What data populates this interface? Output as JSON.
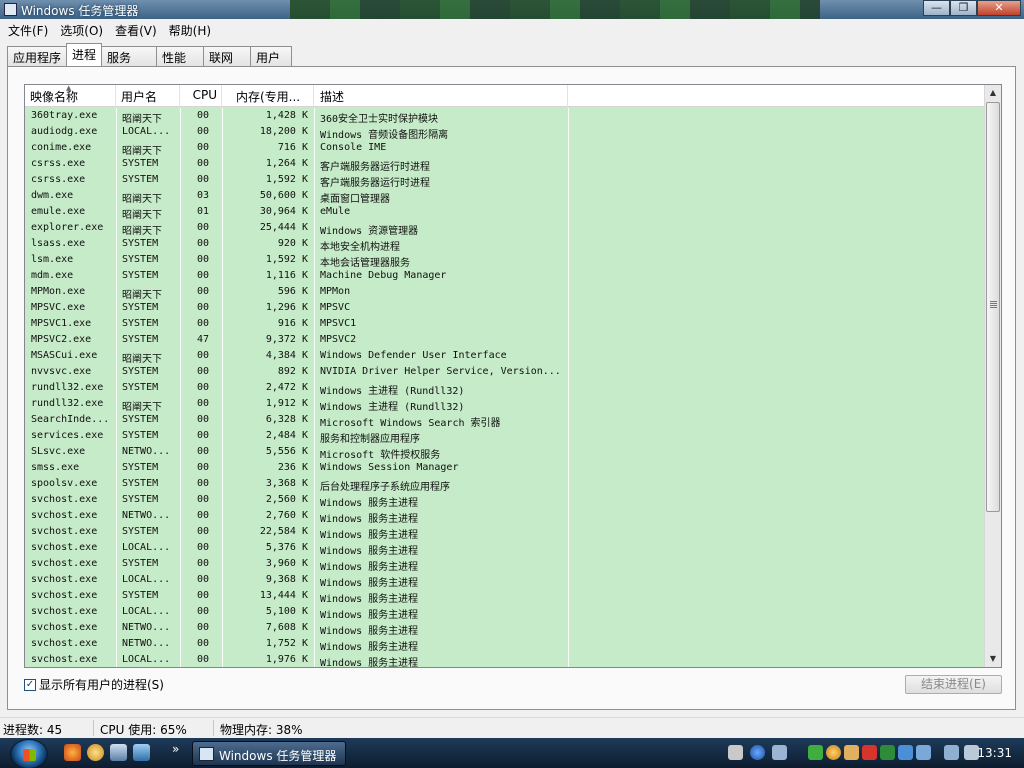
{
  "window": {
    "title": "Windows 任务管理器"
  },
  "menu": [
    "文件(F)",
    "选项(O)",
    "查看(V)",
    "帮助(H)"
  ],
  "tabs": [
    {
      "label": "应用程序",
      "active": false
    },
    {
      "label": "进程",
      "active": true
    },
    {
      "label": "服务",
      "active": false
    },
    {
      "label": "性能",
      "active": false
    },
    {
      "label": "联网",
      "active": false
    },
    {
      "label": "用户",
      "active": false
    }
  ],
  "table": {
    "columns": [
      "映像名称",
      "用户名",
      "CPU",
      "内存(专用...",
      "描述"
    ],
    "rows": [
      [
        "360tray.exe",
        "昭阐天下",
        "00",
        "1,428 K",
        "360安全卫士实时保护模块"
      ],
      [
        "audiodg.exe",
        "LOCAL...",
        "00",
        "18,200 K",
        "Windows 音频设备图形隔离"
      ],
      [
        "conime.exe",
        "昭阐天下",
        "00",
        "716 K",
        "Console IME"
      ],
      [
        "csrss.exe",
        "SYSTEM",
        "00",
        "1,264 K",
        "客户端服务器运行时进程"
      ],
      [
        "csrss.exe",
        "SYSTEM",
        "00",
        "1,592 K",
        "客户端服务器运行时进程"
      ],
      [
        "dwm.exe",
        "昭阐天下",
        "03",
        "50,600 K",
        "桌面窗口管理器"
      ],
      [
        "emule.exe",
        "昭阐天下",
        "01",
        "30,964 K",
        "eMule"
      ],
      [
        "explorer.exe",
        "昭阐天下",
        "00",
        "25,444 K",
        "Windows 资源管理器"
      ],
      [
        "lsass.exe",
        "SYSTEM",
        "00",
        "920 K",
        "本地安全机构进程"
      ],
      [
        "lsm.exe",
        "SYSTEM",
        "00",
        "1,592 K",
        "本地会话管理器服务"
      ],
      [
        "mdm.exe",
        "SYSTEM",
        "00",
        "1,116 K",
        "Machine Debug Manager"
      ],
      [
        "MPMon.exe",
        "昭阐天下",
        "00",
        "596 K",
        "MPMon"
      ],
      [
        "MPSVC.exe",
        "SYSTEM",
        "00",
        "1,296 K",
        "MPSVC"
      ],
      [
        "MPSVC1.exe",
        "SYSTEM",
        "00",
        "916 K",
        "MPSVC1"
      ],
      [
        "MPSVC2.exe",
        "SYSTEM",
        "47",
        "9,372 K",
        "MPSVC2"
      ],
      [
        "MSASCui.exe",
        "昭阐天下",
        "00",
        "4,384 K",
        "Windows Defender User Interface"
      ],
      [
        "nvvsvc.exe",
        "SYSTEM",
        "00",
        "892 K",
        "NVIDIA Driver Helper Service, Version..."
      ],
      [
        "rundll32.exe",
        "SYSTEM",
        "00",
        "2,472 K",
        "Windows 主进程 (Rundll32)"
      ],
      [
        "rundll32.exe",
        "昭阐天下",
        "00",
        "1,912 K",
        "Windows 主进程 (Rundll32)"
      ],
      [
        "SearchInde...",
        "SYSTEM",
        "00",
        "6,328 K",
        "Microsoft Windows Search 索引器"
      ],
      [
        "services.exe",
        "SYSTEM",
        "00",
        "2,484 K",
        "服务和控制器应用程序"
      ],
      [
        "SLsvc.exe",
        "NETWO...",
        "00",
        "5,556 K",
        "Microsoft 软件授权服务"
      ],
      [
        "smss.exe",
        "SYSTEM",
        "00",
        "236 K",
        "Windows Session Manager"
      ],
      [
        "spoolsv.exe",
        "SYSTEM",
        "00",
        "3,368 K",
        "后台处理程序子系统应用程序"
      ],
      [
        "svchost.exe",
        "SYSTEM",
        "00",
        "2,560 K",
        "Windows 服务主进程"
      ],
      [
        "svchost.exe",
        "NETWO...",
        "00",
        "2,760 K",
        "Windows 服务主进程"
      ],
      [
        "svchost.exe",
        "SYSTEM",
        "00",
        "22,584 K",
        "Windows 服务主进程"
      ],
      [
        "svchost.exe",
        "LOCAL...",
        "00",
        "5,376 K",
        "Windows 服务主进程"
      ],
      [
        "svchost.exe",
        "SYSTEM",
        "00",
        "3,960 K",
        "Windows 服务主进程"
      ],
      [
        "svchost.exe",
        "LOCAL...",
        "00",
        "9,368 K",
        "Windows 服务主进程"
      ],
      [
        "svchost.exe",
        "SYSTEM",
        "00",
        "13,444 K",
        "Windows 服务主进程"
      ],
      [
        "svchost.exe",
        "LOCAL...",
        "00",
        "5,100 K",
        "Windows 服务主进程"
      ],
      [
        "svchost.exe",
        "NETWO...",
        "00",
        "7,608 K",
        "Windows 服务主进程"
      ],
      [
        "svchost.exe",
        "NETWO...",
        "00",
        "1,752 K",
        "Windows 服务主进程"
      ],
      [
        "svchost.exe",
        "LOCAL...",
        "00",
        "1,976 K",
        "Windows 服务主进程"
      ]
    ]
  },
  "show_all": {
    "label": "显示所有用户的进程(S)",
    "checked": true
  },
  "end_process_label": "结束进程(E)",
  "status": {
    "processes": "进程数: 45",
    "cpu": "CPU 使用: 65%",
    "memory": "物理内存: 38%"
  },
  "taskbar": {
    "task_label": "Windows 任务管理器",
    "clock": "13:31",
    "more": "»"
  },
  "icons": {
    "window": "task-manager-icon",
    "sort": "sort-arrow-icon",
    "scroll_up": "scroll-up-icon",
    "scroll_down": "scroll-down-icon",
    "check": "checkmark-icon"
  },
  "colors": {
    "list_background": "#c6ebc8",
    "title_bar": "#3d6385",
    "taskbar": "#0d1d2e"
  }
}
